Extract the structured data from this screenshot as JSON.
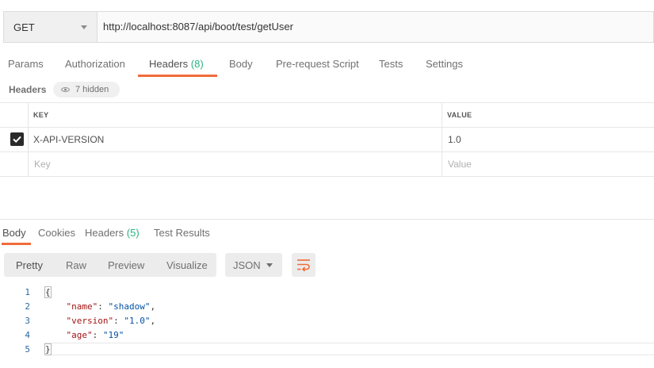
{
  "request": {
    "method": "GET",
    "url": "http://localhost:8087/api/boot/test/getUser"
  },
  "request_tabs": [
    {
      "label": "Params",
      "count": ""
    },
    {
      "label": "Authorization",
      "count": ""
    },
    {
      "label": "Headers",
      "count": "(8)"
    },
    {
      "label": "Body",
      "count": ""
    },
    {
      "label": "Pre-request Script",
      "count": ""
    },
    {
      "label": "Tests",
      "count": ""
    },
    {
      "label": "Settings",
      "count": ""
    }
  ],
  "headers_section": {
    "title": "Headers",
    "hidden_label": "7 hidden",
    "columns": {
      "key": "KEY",
      "value": "VALUE"
    },
    "rows": [
      {
        "checked": true,
        "key": "X-API-VERSION",
        "value": "1.0"
      }
    ],
    "placeholder": {
      "key": "Key",
      "value": "Value"
    }
  },
  "response_tabs": [
    {
      "label": "Body",
      "count": ""
    },
    {
      "label": "Cookies",
      "count": ""
    },
    {
      "label": "Headers",
      "count": "(5)"
    },
    {
      "label": "Test Results",
      "count": ""
    }
  ],
  "body_toolbar": {
    "formats": [
      "Pretty",
      "Raw",
      "Preview",
      "Visualize"
    ],
    "language": "JSON"
  },
  "response_body": {
    "line_numbers": [
      "1",
      "2",
      "3",
      "4",
      "5"
    ],
    "open_brace": "{",
    "close_brace": "}",
    "fields": [
      {
        "key": "\"name\"",
        "value": "\"shadow\"",
        "sep": ","
      },
      {
        "key": "\"version\"",
        "value": "\"1.0\"",
        "sep": ","
      },
      {
        "key": "\"age\"",
        "value": "\"19\"",
        "sep": ""
      }
    ]
  },
  "colors": {
    "accent": "#f26b3a",
    "count_green": "#26b47f",
    "json_key": "#a31515",
    "json_string": "#0451a5"
  }
}
